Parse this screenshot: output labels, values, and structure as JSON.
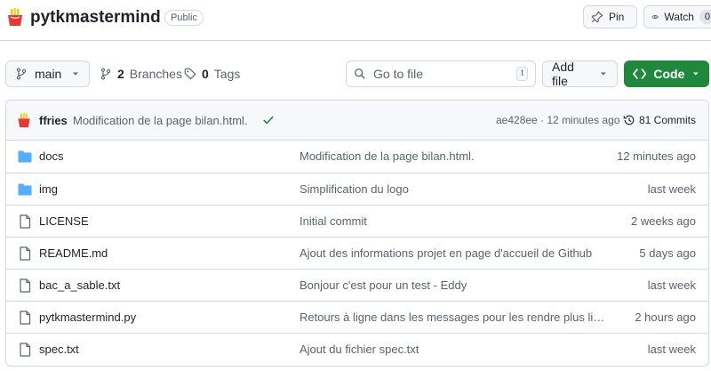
{
  "repo": {
    "name": "pytkmastermind",
    "visibility": "Public",
    "pin_label": "Pin",
    "watch_label": "Watch",
    "watch_count": "0"
  },
  "toolbar": {
    "branch": "main",
    "branches_count": "2",
    "branches_label": "Branches",
    "tags_count": "0",
    "tags_label": "Tags",
    "search_placeholder": "Go to file",
    "search_shortcut": "t",
    "add_file_label": "Add file",
    "code_label": "Code"
  },
  "latest_commit": {
    "author": "ffries",
    "message": "Modification de la page bilan.html.",
    "sha_time": "ae428ee · 12 minutes ago",
    "commits_label": "81 Commits"
  },
  "files": [
    {
      "type": "folder",
      "name": "docs",
      "commit": "Modification de la page bilan.html.",
      "time": "12 minutes ago"
    },
    {
      "type": "folder",
      "name": "img",
      "commit": "Simplification du logo",
      "time": "last week"
    },
    {
      "type": "file",
      "name": "LICENSE",
      "commit": "Initial commit",
      "time": "2 weeks ago"
    },
    {
      "type": "file",
      "name": "README.md",
      "commit": "Ajout des informations projet en page d'accueil de Github",
      "time": "5 days ago"
    },
    {
      "type": "file",
      "name": "bac_a_sable.txt",
      "commit": "Bonjour c'est pour un test - Eddy",
      "time": "last week"
    },
    {
      "type": "file",
      "name": "pytkmastermind.py",
      "commit": "Retours à ligne dans les messages pour les rendre plus lisibles",
      "time": "2 hours ago"
    },
    {
      "type": "file",
      "name": "spec.txt",
      "commit": "Ajout du fichier spec.txt",
      "time": "last week"
    }
  ],
  "colors": {
    "folder": "#54aeff",
    "code_button": "#1f883d",
    "check": "#1a7f37"
  }
}
